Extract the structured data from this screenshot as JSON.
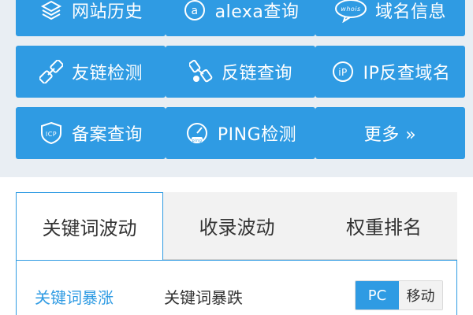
{
  "tools": [
    {
      "label": "网站历史",
      "icon": "stack-icon"
    },
    {
      "label": "alexa查询",
      "icon": "alexa-icon"
    },
    {
      "label": "域名信息",
      "icon": "whois-icon"
    },
    {
      "label": "友链检测",
      "icon": "link-icon"
    },
    {
      "label": "反链查询",
      "icon": "backlink-icon"
    },
    {
      "label": "IP反查域名",
      "icon": "ip-icon"
    },
    {
      "label": "备案查询",
      "icon": "icp-icon"
    },
    {
      "label": "PING检测",
      "icon": "ping-gauge-icon"
    },
    {
      "label": "更多 »",
      "icon": ""
    }
  ],
  "icon_text": {
    "alexa": "a",
    "whois": "whois",
    "ip": "iP",
    "icp": "ICP",
    "ping": "ping"
  },
  "tabs": [
    {
      "label": "关键词波动",
      "active": true
    },
    {
      "label": "收录波动",
      "active": false
    },
    {
      "label": "权重排名",
      "active": false
    }
  ],
  "subtabs": [
    {
      "label": "关键词暴涨",
      "active": true
    },
    {
      "label": "关键词暴跌",
      "active": false
    }
  ],
  "device_toggle": {
    "options": [
      "PC",
      "移动"
    ],
    "selected": "PC"
  },
  "colors": {
    "accent": "#2f9be3",
    "background": "#e9eef3"
  }
}
